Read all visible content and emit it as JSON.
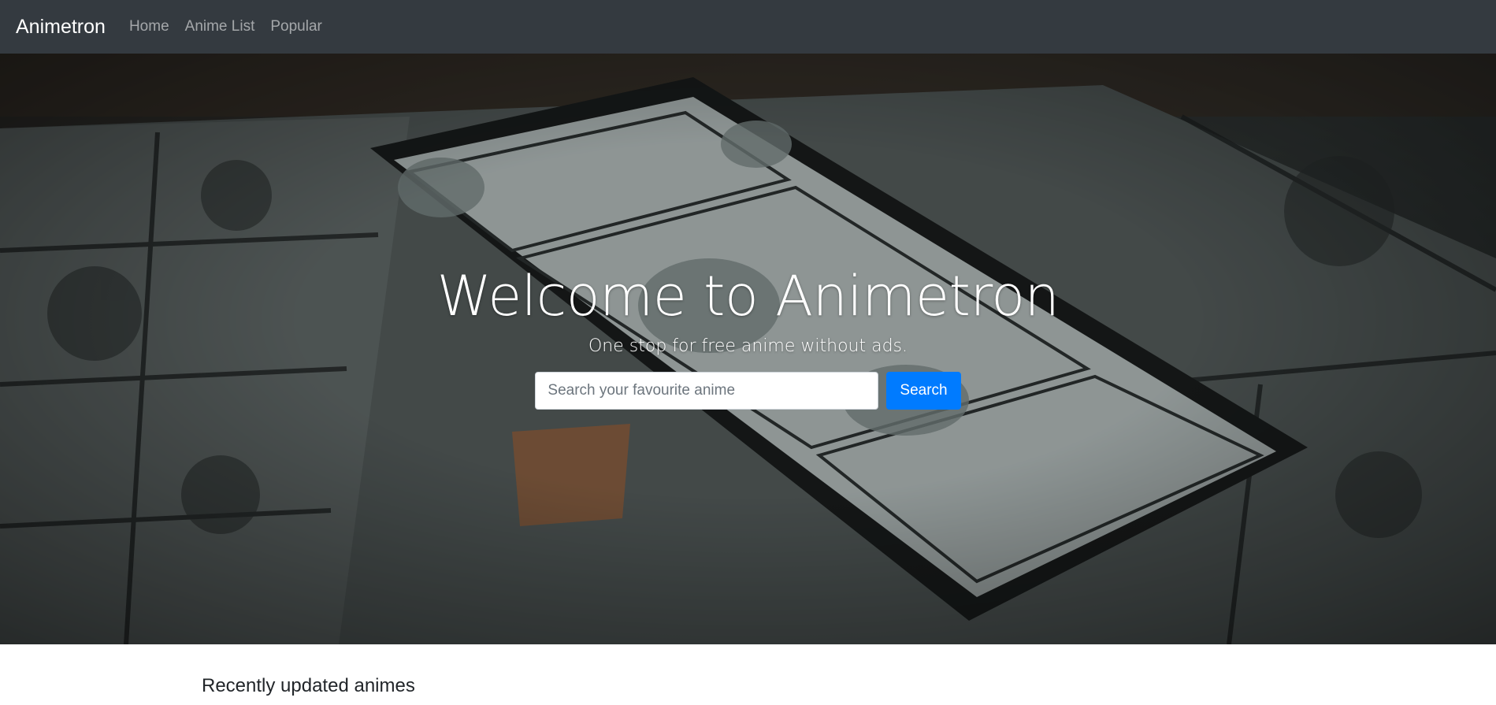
{
  "navbar": {
    "brand": "Animetron",
    "links": [
      "Home",
      "Anime List",
      "Popular"
    ]
  },
  "hero": {
    "title": "Welcome to Animetron",
    "subtitle": "One stop for free anime without ads.",
    "search": {
      "placeholder": "Search your favourite anime",
      "value": "",
      "button_label": "Search"
    }
  },
  "section": {
    "title": "Recently updated animes"
  },
  "colors": {
    "navbar_bg": "#343a40",
    "primary": "#007bff"
  },
  "icons": {
    "hero_background": "manga-phone-photo"
  }
}
